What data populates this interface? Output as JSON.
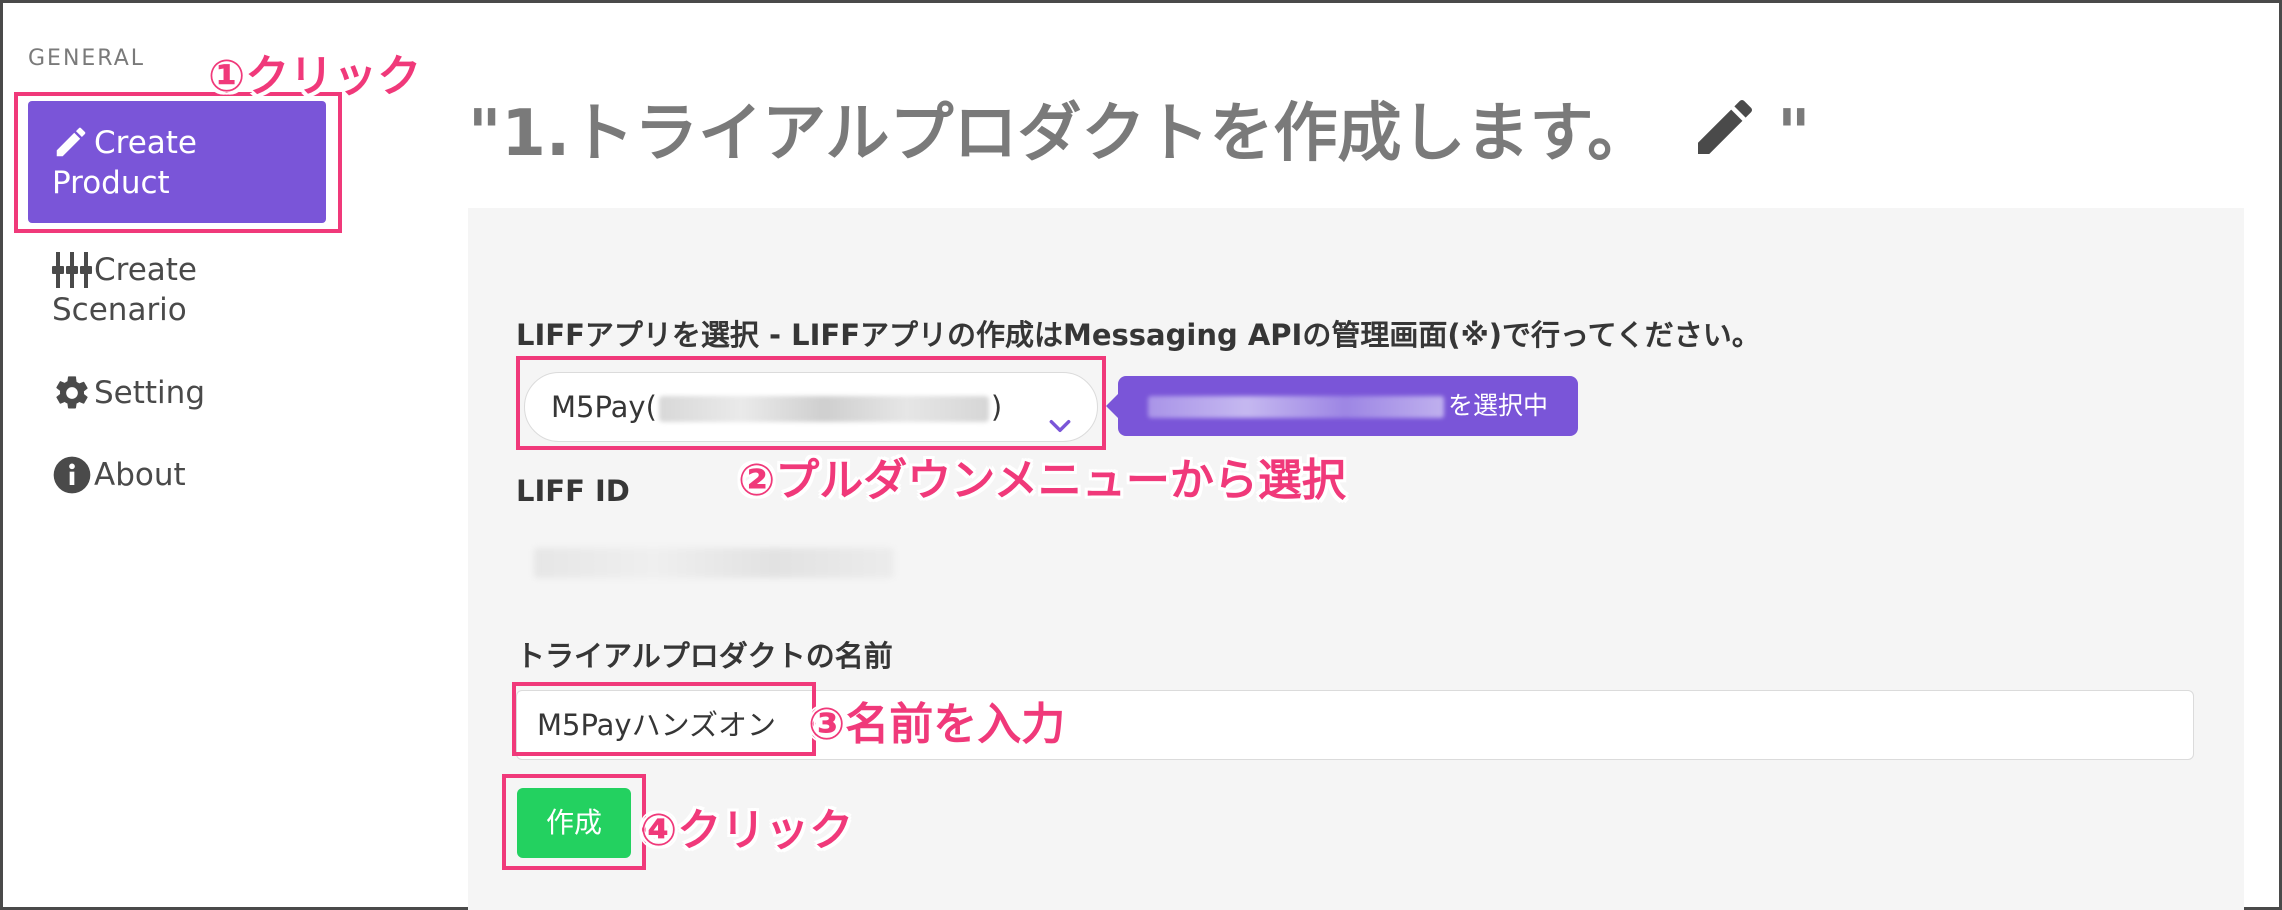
{
  "sidebar": {
    "section_label": "GENERAL",
    "items": [
      {
        "label": "Create Product",
        "icon": "pencil-icon",
        "active": true
      },
      {
        "label": "Create Scenario",
        "icon": "sliders-icon",
        "active": false
      },
      {
        "label": "Setting",
        "icon": "gear-icon",
        "active": false
      },
      {
        "label": "About",
        "icon": "info-icon",
        "active": false
      }
    ]
  },
  "main": {
    "title_open": "\"1.トライアルプロダクトを作成します。",
    "title_icon": "pencil-icon",
    "title_close": "\"",
    "liff_label": "LIFFアプリを選択 - LIFFアプリの作成はMessaging APIの管理画面(※)で行ってください。",
    "liff_select": {
      "prefix": "M5Pay(",
      "suffix": ")"
    },
    "liff_tag_suffix": "を選択中",
    "liff_id_label": "LIFF ID",
    "name_label": "トライアルプロダクトの名前",
    "name_value": "M5Payハンズオン",
    "create_button": "作成"
  },
  "annotations": {
    "step1": "①クリック",
    "step2": "②プルダウンメニューから選択",
    "step3": "③名前を入力",
    "step4": "④クリック"
  },
  "colors": {
    "accent_purple": "#7a55d8",
    "success_green": "#23d160",
    "annotation_pink": "#f0397a"
  }
}
